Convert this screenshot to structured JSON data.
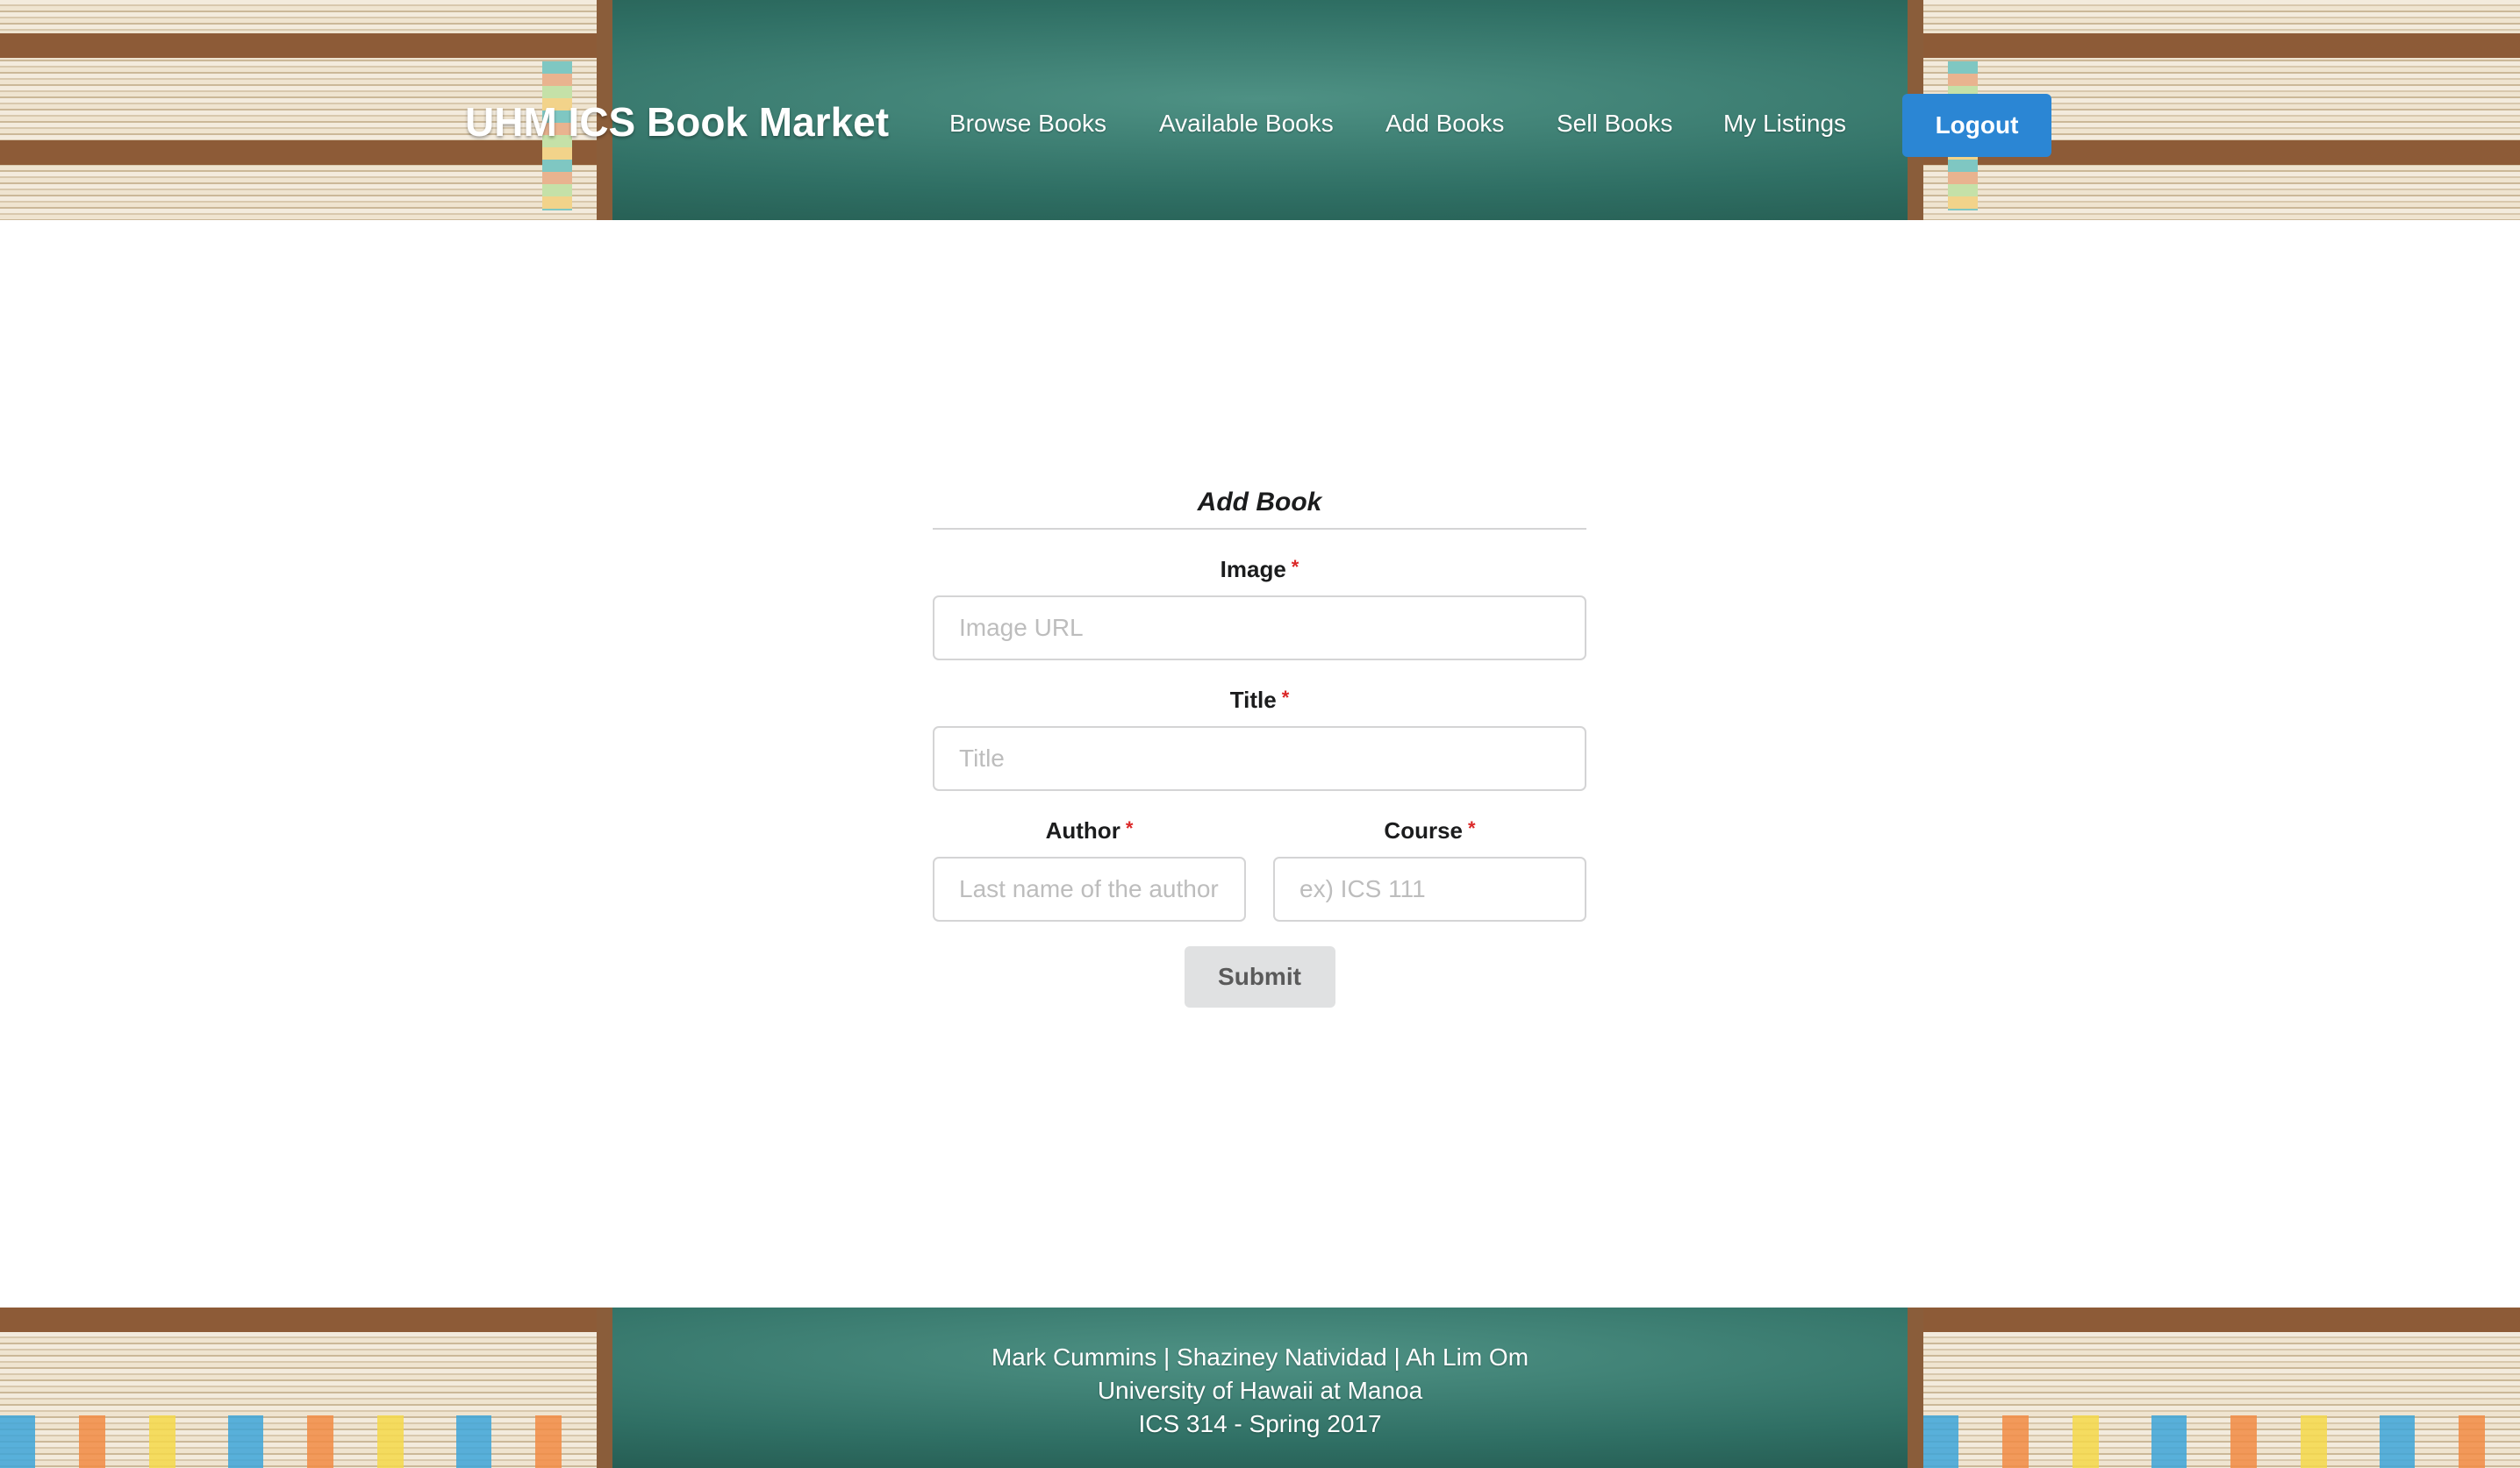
{
  "header": {
    "brand": "UHM ICS Book Market",
    "nav": [
      "Browse Books",
      "Available Books",
      "Add Books",
      "Sell Books",
      "My Listings"
    ],
    "logout_label": "Logout",
    "accent_color": "#2b86d4"
  },
  "form": {
    "title": "Add Book",
    "image": {
      "label": "Image",
      "placeholder": "Image URL",
      "value": ""
    },
    "title_field": {
      "label": "Title",
      "placeholder": "Title",
      "value": ""
    },
    "author": {
      "label": "Author",
      "placeholder": "Last name of the author",
      "value": ""
    },
    "course": {
      "label": "Course",
      "placeholder": "ex) ICS 111",
      "value": ""
    },
    "required_marker": "*",
    "submit_label": "Submit"
  },
  "footer": {
    "line1": "Mark Cummins | Shaziney Natividad | Ah Lim Om",
    "line2": "University of Hawaii at Manoa",
    "line3": "ICS 314 - Spring 2017"
  }
}
